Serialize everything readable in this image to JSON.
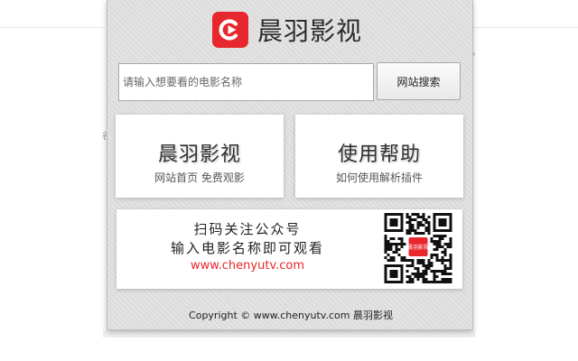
{
  "background": {
    "fragments": [
      "v",
      "谷"
    ]
  },
  "brand": {
    "name": "晨羽影视",
    "logo_icon": "play-logo-icon",
    "accent": "#e8262d"
  },
  "search": {
    "placeholder": "请输入想要看的电影名称",
    "value": "",
    "button_label": "网站搜索"
  },
  "cards": {
    "home": {
      "title": "晨羽影视",
      "subtitle": "网站首页 免费观影"
    },
    "help": {
      "title": "使用帮助",
      "subtitle": "如何使用解析插件"
    }
  },
  "qr_card": {
    "line1": "扫码关注公众号",
    "line2": "输入电影名称即可观看",
    "url": "www.chenyutv.com",
    "qr_badge": "晨羽影视"
  },
  "footer": {
    "copyright": "Copyright © www.chenyutv.com 晨羽影视"
  }
}
